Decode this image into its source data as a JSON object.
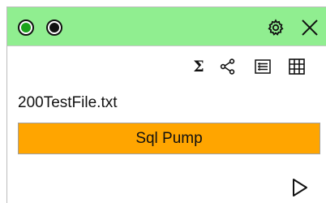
{
  "header": {
    "status_dots": [
      "running-indicator",
      "stopped-indicator"
    ],
    "accent_color": "#90ee90",
    "icons": [
      "gear-icon",
      "close-icon"
    ]
  },
  "toolbar": {
    "sum_label": "Σ",
    "icons": [
      "sum-icon",
      "flow-icon",
      "list-icon",
      "grid-icon"
    ]
  },
  "content": {
    "filename": "200TestFile.txt",
    "component_label": "Sql Pump",
    "component_color": "#ffa500"
  },
  "footer": {
    "icons": [
      "play-icon"
    ]
  }
}
